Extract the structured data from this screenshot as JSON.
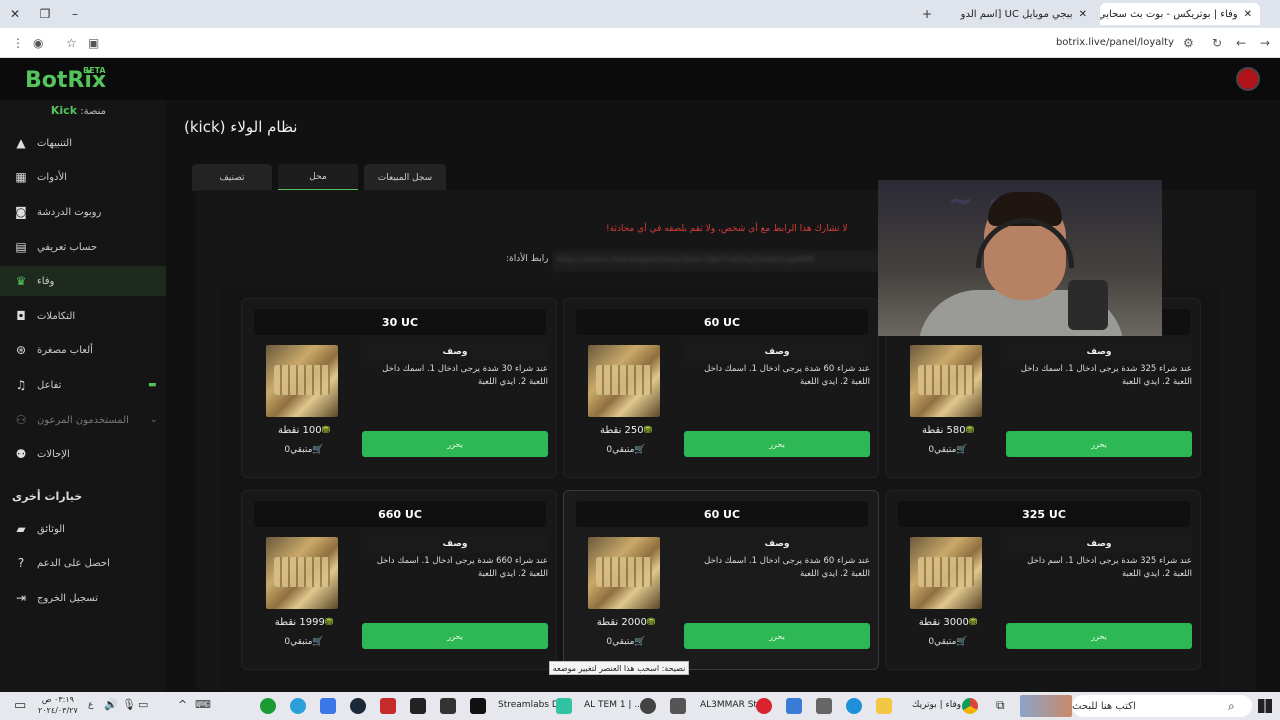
{
  "browser": {
    "tabs": [
      {
        "title": "وفاء | بوتريكس - بوت بث سحابي"
      },
      {
        "title": "ببجي موبايل UC [اسم الدولة] | خـ"
      }
    ],
    "url": "botrix.live/panel/loyalty"
  },
  "app": {
    "logo": "BotRix",
    "logo_badge": "BETA",
    "platform_label": "منصة:",
    "platform_value": "Kick"
  },
  "sidebar": {
    "items": [
      {
        "label": "التنبيهات",
        "icon": "warning-icon"
      },
      {
        "label": "الأدوات",
        "icon": "widgets-icon"
      },
      {
        "label": "روبوت الدردشة",
        "icon": "bot-icon"
      },
      {
        "label": "حساب تعريفي",
        "icon": "profile-card-icon"
      },
      {
        "label": "وفاء",
        "icon": "trophy-icon"
      },
      {
        "label": "التكاملات",
        "icon": "integrations-icon"
      },
      {
        "label": "ألعاب مصغرة",
        "icon": "gamepad-icon"
      },
      {
        "label": "تفاعل",
        "icon": "music-icon"
      },
      {
        "label": "المستخدمون المرعون",
        "icon": "users-icon"
      },
      {
        "label": "الإحالات",
        "icon": "referrals-icon"
      }
    ],
    "other_heading": "خيارات أخرى",
    "other_items": [
      {
        "label": "الوثائق",
        "icon": "docs-icon"
      },
      {
        "label": "احصل على الدعم",
        "icon": "help-icon"
      },
      {
        "label": "تسجيل الخروج",
        "icon": "logout-icon"
      }
    ]
  },
  "page": {
    "title": "نظام الولاء (kick)",
    "tabs": [
      "تصنيف",
      "محل",
      "سجل المبيعات"
    ],
    "warning": "لا تشارك هذا الرابط مع أي شخص، ولا تقم بلصقه في أي محادثة!",
    "link_label": "رابط الأداة:",
    "link_value": "https://botrix.live/widgets/shop?bid=1Ne7hXGhuZaxbe1vgsKMB"
  },
  "cards": [
    {
      "title": "30 UC",
      "desc_head": "وصف",
      "desc": "عند شراء 30 شدة يرجى ادخال 1. اسمك داخل اللعبة 2. ايدي اللعبة",
      "points": "100 نقطة",
      "stock": "متبقي0",
      "button": "يحرر"
    },
    {
      "title": "60 UC",
      "desc_head": "وصف",
      "desc": "عند شراء 60 شدة يرجى ادخال 1. اسمك داخل اللعبة 2. ايدي اللعبة",
      "points": "250 نقطة",
      "stock": "متبقي0",
      "button": "يحرر"
    },
    {
      "title": "",
      "desc_head": "وصف",
      "desc": "عند شراء 325 شدة يرجى ادخال 1. اسمك داخل اللعبة 2. ايدي اللعبة",
      "points": "580 نقطة",
      "stock": "متبقي0",
      "button": "يحرر"
    },
    {
      "title": "660 UC",
      "desc_head": "وصف",
      "desc": "عند شراء 660 شدة يرجى ادخال 1. اسمك داخل اللعبة 2. ايدي اللعبة",
      "points": "1999 نقطة",
      "stock": "متبقي0",
      "button": "يحرر"
    },
    {
      "title": "60 UC",
      "desc_head": "وصف",
      "desc": "عند شراء 60 شدة يرجى ادخال 1. اسمك داخل اللعبة 2. ايدي اللعبة",
      "points": "2000 نقطة",
      "stock": "متبقي0",
      "button": "يحرر"
    },
    {
      "title": "325 UC",
      "desc_head": "وصف",
      "desc": "عند شراء 325 شدة يرجى ادخال 1. اسم داخل اللعبة 2. ايدي اللعبة",
      "points": "3000 نقطة",
      "stock": "متبقي0",
      "button": "يحرر"
    }
  ],
  "tooltip": "نصيحة: اسحب هذا العنصر لتغيير موضعه",
  "taskbar": {
    "search_placeholder": "اكتب هنا للبحث",
    "time": "٠٣:١٩ ص",
    "date": "٢٠٢٤/٠٣/٢٧",
    "apps": [
      "Streamlabs D...",
      "AL TEM 1 | ...",
      "AL3MMAR St...",
      "وفاء | بوتريك..."
    ]
  },
  "colors": {
    "accent": "#54c35b",
    "button": "#2db755",
    "warning": "#d93b3b"
  }
}
